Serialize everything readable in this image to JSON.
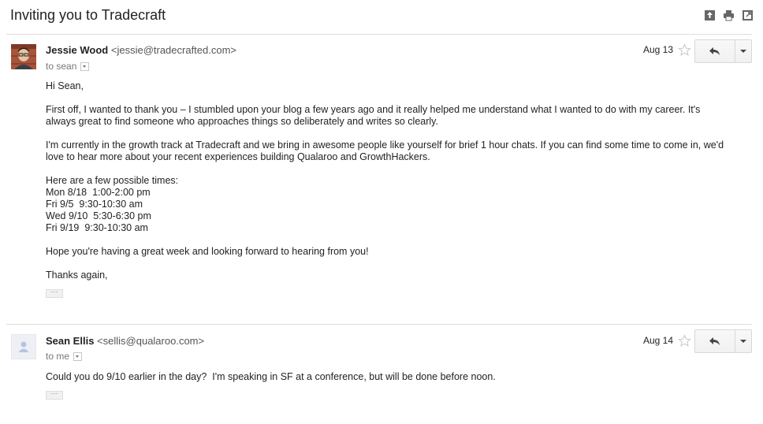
{
  "subject": "Inviting you to Tradecraft",
  "toolbar_icons": [
    "expand-icon",
    "print-icon",
    "new-window-icon"
  ],
  "messages": [
    {
      "sender_name": "Jessie Wood",
      "sender_email": "<jessie@tradecrafted.com>",
      "to": "to sean",
      "date": "Aug 13",
      "body": {
        "greeting": "Hi Sean,",
        "p1": "First off, I wanted to thank you – I stumbled upon your blog a few years ago and it really helped me understand what I wanted to do with my career. It's always great to find someone who approaches things so deliberately and writes so clearly.",
        "p2": "I'm currently in the growth track at Tradecraft and we bring in awesome people like yourself for brief 1 hour chats. If you can find some time to come in, we'd love to hear more about your recent experiences building Qualaroo and GrowthHackers.",
        "times_intro": "Here are a few possible times:",
        "times": [
          "Mon 8/18  1:00-2:00 pm",
          "Fri 9/5  9:30-10:30 am",
          "Wed 9/10  5:30-6:30 pm",
          "Fri 9/19  9:30-10:30 am"
        ],
        "p3": "Hope you're having a great week and looking forward to hearing from you!",
        "closing": "Thanks again,"
      }
    },
    {
      "sender_name": "Sean Ellis",
      "sender_email": "<sellis@qualaroo.com>",
      "to": "to me",
      "date": "Aug 14",
      "body": {
        "p1": "Could you do 9/10 earlier in the day?  I'm speaking in SF at a conference, but will be done before noon."
      }
    }
  ],
  "ellipsis": "···"
}
